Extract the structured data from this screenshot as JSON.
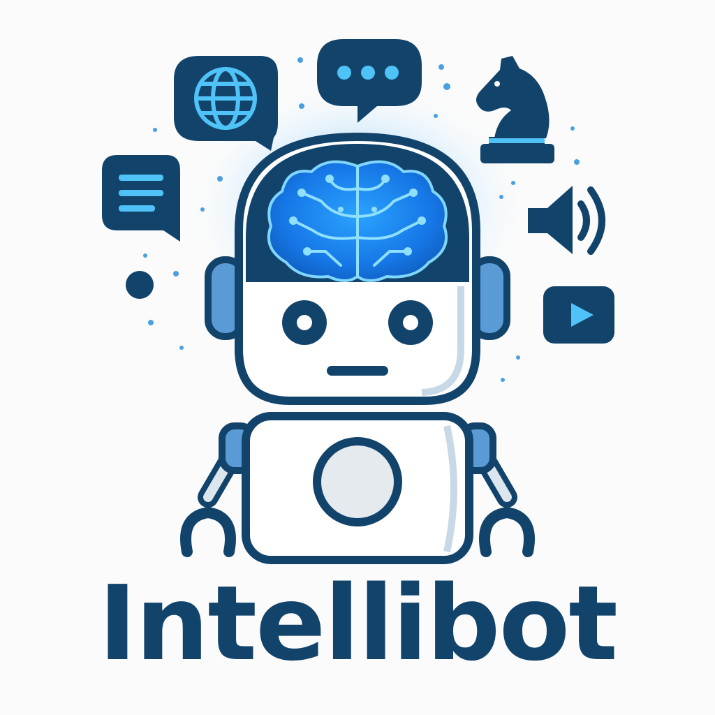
{
  "brand": {
    "name": "Intellibot"
  },
  "colors": {
    "navy": "#12436b",
    "glow_blue": "#1e90ff",
    "light_blue": "#4fc3f7",
    "mid_blue": "#5b9bd5",
    "background": "#fbfbfb",
    "face_white": "#ffffff"
  },
  "icons": [
    "globe-chat-icon",
    "typing-chat-bubble-icon",
    "chess-knight-icon",
    "message-lines-icon",
    "speaker-volume-icon",
    "video-play-icon",
    "brain-circuit-icon",
    "robot-mascot"
  ]
}
